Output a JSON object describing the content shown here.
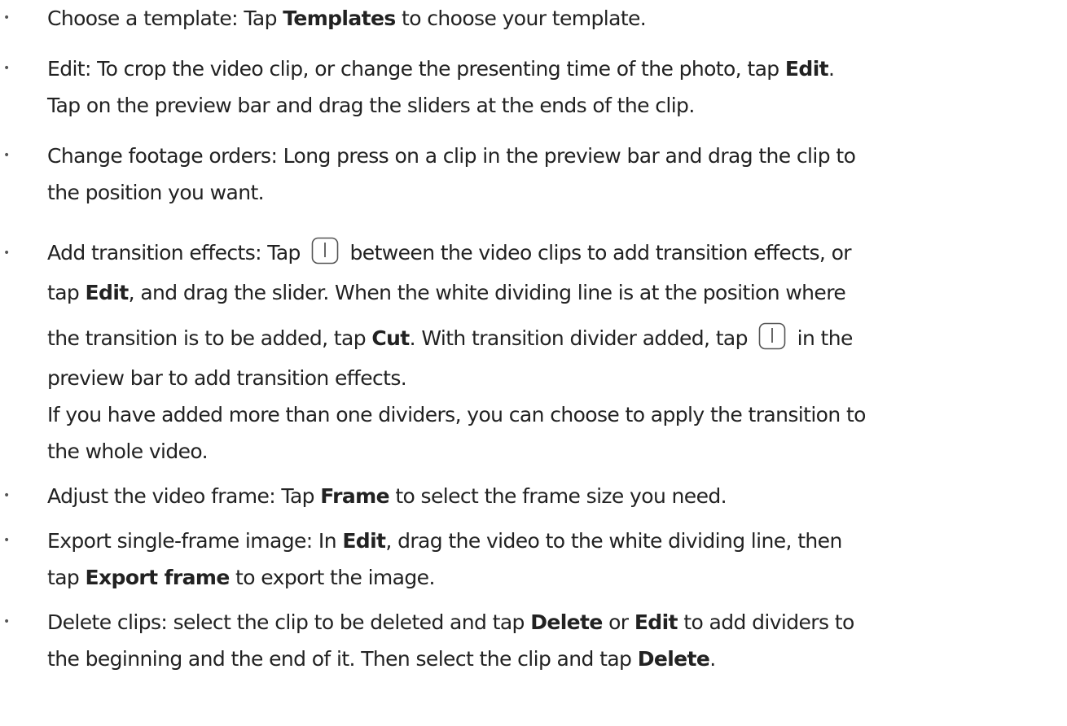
{
  "items": [
    {
      "lines": [
        {
          "pre": "Choose a template: Tap ",
          "b1": "Templates",
          "post": " to choose your template."
        }
      ]
    },
    {
      "lines": [
        {
          "pre": "Edit: To crop the video clip, or change the presenting time of the photo, tap ",
          "b1": "Edit",
          "post": "."
        },
        {
          "text": "Tap on the preview bar and drag the sliders at the ends of the clip."
        }
      ]
    },
    {
      "lines": [
        {
          "text": "Change footage orders: Long press on a clip in the preview bar and drag the clip to"
        },
        {
          "text": "the position you want."
        }
      ]
    },
    {
      "lines": [
        {
          "pre": "Add transition effects: Tap ",
          "post": " between the video clips to add transition effects, or"
        },
        {
          "pre": "tap ",
          "b1": "Edit",
          "post": ", and drag the slider. When the white dividing line is at the position where"
        },
        {
          "pre": "the transition is to be added, tap ",
          "b1": "Cut",
          "mid": ". With transition divider added, tap ",
          "post": " in the"
        },
        {
          "text": "preview bar to add transition effects."
        },
        {
          "text": "If you have added more than one dividers, you can choose to apply the transition to"
        },
        {
          "text": "the whole video."
        }
      ],
      "icon": "transition-divider-icon"
    },
    {
      "lines": [
        {
          "pre": "Adjust the video frame: Tap ",
          "b1": "Frame",
          "post": " to select the frame size you need."
        }
      ]
    },
    {
      "lines": [
        {
          "pre": "Export single-frame image: In ",
          "b1": "Edit",
          "post": ", drag the video to the white dividing line, then"
        },
        {
          "pre": "tap ",
          "b1": "Export frame",
          "post": " to export the image."
        }
      ]
    },
    {
      "lines": [
        {
          "pre": "Delete clips: select the clip to be deleted and tap ",
          "b1": "Delete",
          "mid": " or ",
          "b2": "Edit",
          "post": " to add dividers to"
        },
        {
          "pre": "the beginning and the end of it. Then select the clip and tap ",
          "b1": "Delete",
          "post": "."
        }
      ]
    }
  ],
  "bullet_char": "•"
}
